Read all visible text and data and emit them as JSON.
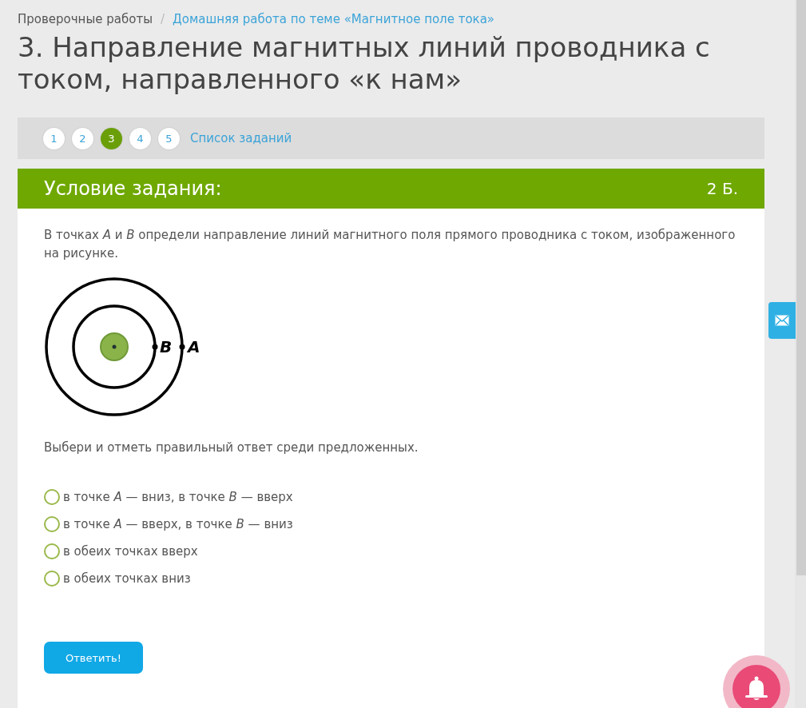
{
  "breadcrumb": {
    "parent": "Проверочные работы",
    "separator": "/",
    "current": "Домашняя работа по теме «Магнитное поле тока»"
  },
  "title": "3. Направление магнитных линий проводника с током, направленного «к нам»",
  "pager": {
    "items": [
      {
        "label": "1",
        "selected": false
      },
      {
        "label": "2",
        "selected": false
      },
      {
        "label": "3",
        "selected": true
      },
      {
        "label": "4",
        "selected": false
      },
      {
        "label": "5",
        "selected": false
      }
    ],
    "list_link": "Список заданий"
  },
  "task": {
    "header": "Условие задания:",
    "points": "2 Б.",
    "question": "В точках *A* и *B* определи направление линий магнитного поля прямого проводника с током, изображенного на рисунке.",
    "figure": {
      "labels": [
        "B",
        "A"
      ]
    },
    "instruction": "Выбери и отметь правильный ответ среди предложенных.",
    "options": [
      {
        "text": "в точке *A* — вниз, в точке *B* — вверх",
        "selected": false
      },
      {
        "text": "в точке *A* — вверх, в точке *B* — вниз",
        "selected": false
      },
      {
        "text": "в обеих точках вверх",
        "selected": false
      },
      {
        "text": "в обеих точках вниз",
        "selected": false
      }
    ],
    "submit": "Ответить!"
  }
}
